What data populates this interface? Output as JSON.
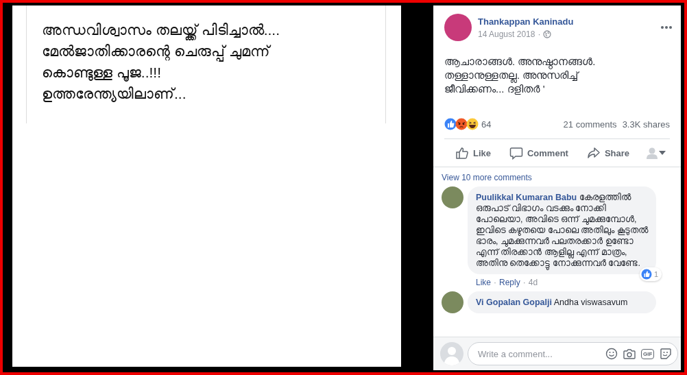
{
  "meme_image": {
    "caption_lines": [
      "അന്ധവിശ്വാസം തലയ്ക്ക് പിടിച്ചാൽ....",
      "മേൽജാതിക്കാരന്റെ ചെരുപ്പ് ചുമന്ന്",
      "കൊണ്ടുള്ള പൂജ..!!!",
      "ഉത്തരേന്ത്യയിലാണ്..."
    ]
  },
  "post": {
    "author": "Thankappan Kaninadu",
    "date": "14 August 2018",
    "separator": "·",
    "text": "ആചാരാങ്ങൾ. അനുഷ്ഠാനങ്ങൾ. തള്ളാനുള്ളതല്ല. അനുസരിച്ച് ജീവിക്കണം... ദളിതർ '",
    "reactions": [
      {
        "kind": "like"
      },
      {
        "kind": "angry"
      },
      {
        "kind": "haha"
      }
    ],
    "reaction_count": "64",
    "comments_count": "21 comments",
    "shares_count": "3.3K shares",
    "actions": [
      {
        "kind": "like",
        "label": "Like"
      },
      {
        "kind": "comment",
        "label": "Comment"
      },
      {
        "kind": "share",
        "label": "Share"
      }
    ]
  },
  "comments": {
    "view_more": "View 10 more comments",
    "items": [
      {
        "author": "Puulikkal Kumaran Babu",
        "text": "കേരളത്തിൽ ഒരുപാട് വിഭാഗം വടക്കും നോക്കി പോലെയാ, അവിടെ ഒന്ന് ചുമക്കുമ്പോൾ, ഇവിടെ കഴുതയെ പോലെ അതിലും കൂടുതൽ ഭാരം, ചുമക്കുന്നവർ പലതരക്കാർ ഉണ്ടോ എന്ന് തിരക്കാൻ ആളില്ല എന്ന് മാത്രം, അതിനു തെക്കോട്ടു നോക്കുന്നവർ വേണ്ടേ.",
        "actions": [
          "Like",
          "Reply"
        ],
        "separator": "·",
        "time": "4d",
        "like_count": "1"
      },
      {
        "author": "Vi Gopalan Gopalji",
        "text": "Andha viswasavum"
      }
    ]
  },
  "composer": {
    "placeholder": "Write a comment...",
    "gif_label": "GIF"
  }
}
